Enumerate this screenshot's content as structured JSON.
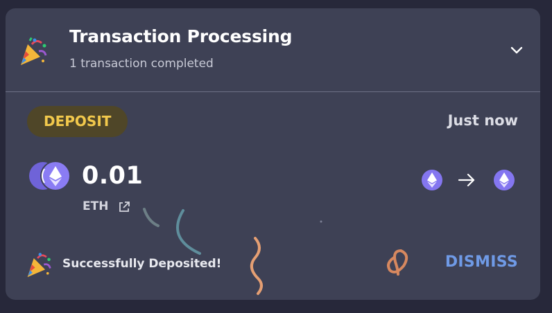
{
  "notification": {
    "emoji": "party-popper-icon",
    "title": "Transaction Processing",
    "subtitle": "1 transaction completed"
  },
  "transaction": {
    "type_badge": "DEPOSIT",
    "time": "Just now",
    "amount": "0.01",
    "token": "ETH",
    "from_network_icon": "ethereum-icon",
    "to_network_icon": "ethereum-icon"
  },
  "footer": {
    "status": "Successfully Deposited!",
    "dismiss_label": "DISMISS"
  },
  "colors": {
    "card_bg": "#3e4155",
    "page_bg": "#27283a",
    "badge_bg": "#4f4628",
    "badge_text": "#f2c94c",
    "eth_purple": "#8476f0",
    "dismiss": "#6f9ae6"
  }
}
